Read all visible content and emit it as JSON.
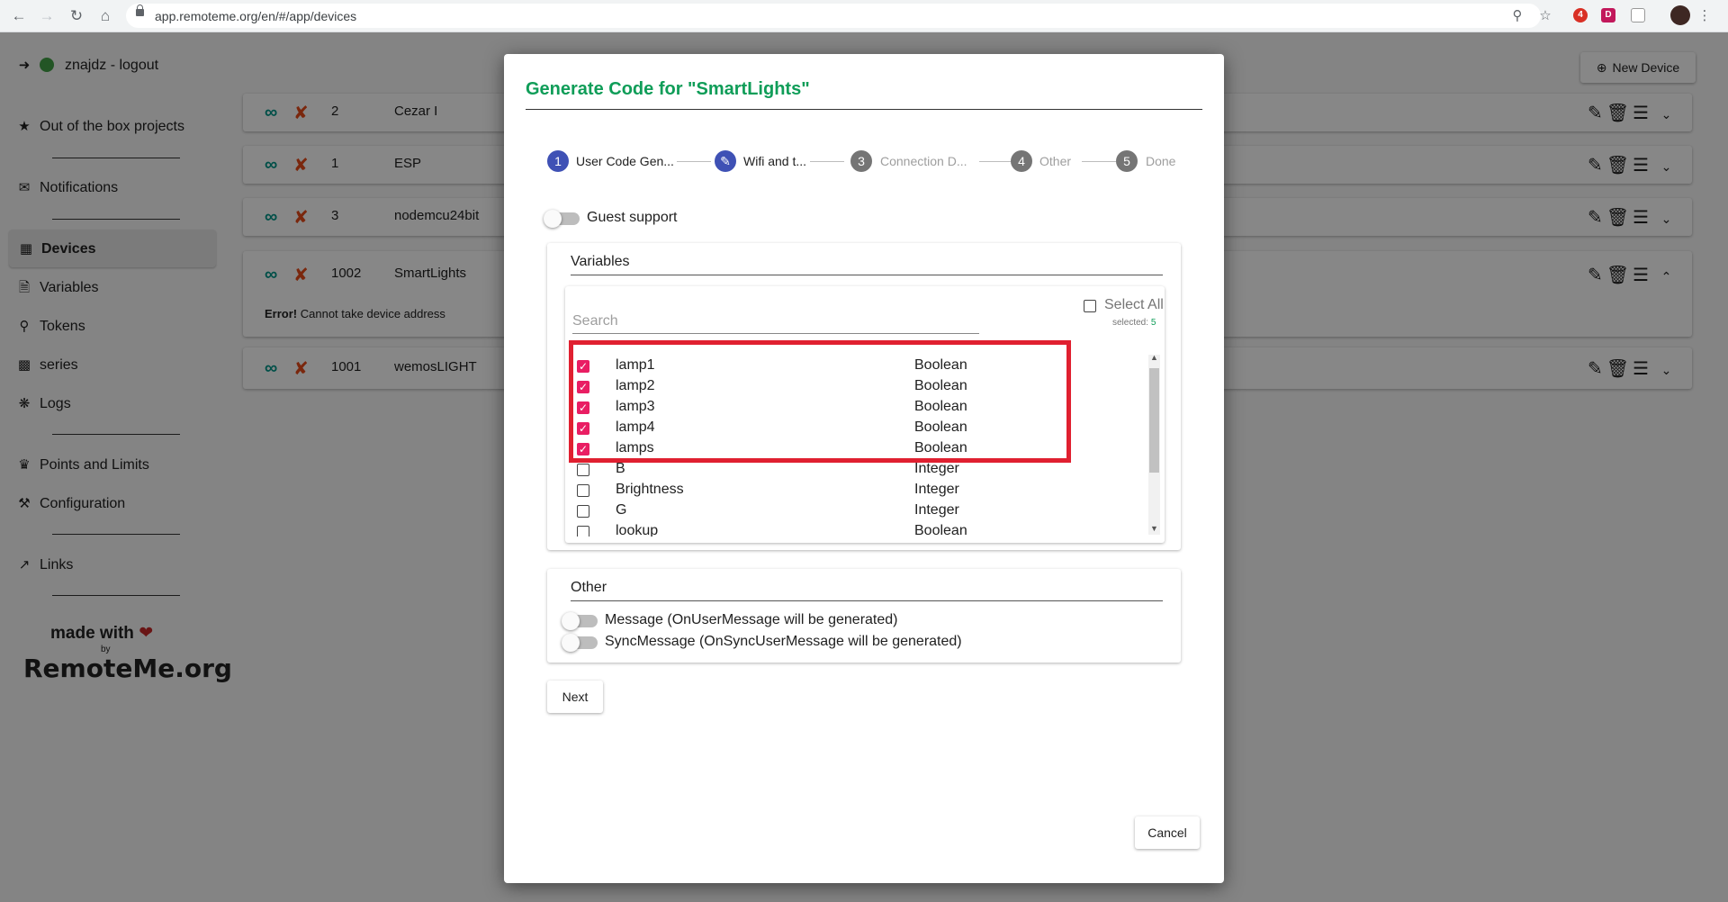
{
  "browser": {
    "url": "app.remoteme.org/en/#/app/devices",
    "extension_badge": "4",
    "extension_letter": "D"
  },
  "sidebar": {
    "user": "znajdz - logout",
    "items": [
      {
        "label": "Out of the box projects",
        "icon": "star-icon"
      },
      {
        "label": "Notifications",
        "icon": "envelope-icon"
      },
      {
        "label": "Devices",
        "icon": "chip-icon"
      },
      {
        "label": "Variables",
        "icon": "file-code-icon"
      },
      {
        "label": "Tokens",
        "icon": "key-icon"
      },
      {
        "label": "series",
        "icon": "bar-chart-icon"
      },
      {
        "label": "Logs",
        "icon": "bug-icon"
      },
      {
        "label": "Points and Limits",
        "icon": "trophy-icon"
      },
      {
        "label": "Configuration",
        "icon": "wrench-icon"
      },
      {
        "label": "Links",
        "icon": "external-link-icon"
      }
    ],
    "made_with": "made with",
    "by": "by",
    "logo": "RemoteMe.org"
  },
  "devices": [
    {
      "id": "2",
      "name": "Cezar I"
    },
    {
      "id": "1",
      "name": "ESP"
    },
    {
      "id": "3",
      "name": "nodemcu24bit"
    },
    {
      "id": "1002",
      "name": "SmartLights",
      "error_label": "Error!",
      "error_text": "Cannot take device address"
    },
    {
      "id": "1001",
      "name": "wemosLIGHT"
    }
  ],
  "new_device_label": "New Device",
  "dialog": {
    "title": "Generate Code for \"SmartLights\"",
    "steps": [
      {
        "num": "1",
        "label": "User Code Gen...",
        "state": "active"
      },
      {
        "num": "",
        "label": "Wifi and t...",
        "state": "edit"
      },
      {
        "num": "3",
        "label": "Connection D...",
        "state": "inactive"
      },
      {
        "num": "4",
        "label": "Other",
        "state": "inactive"
      },
      {
        "num": "5",
        "label": "Done",
        "state": "inactive"
      }
    ],
    "guest_support": "Guest support",
    "variables_title": "Variables",
    "select_all": "Select All",
    "selected_label": "selected:",
    "selected_count": "5",
    "search_placeholder": "Search",
    "variables": [
      {
        "name": "lamp1",
        "type": "Boolean",
        "checked": true
      },
      {
        "name": "lamp2",
        "type": "Boolean",
        "checked": true
      },
      {
        "name": "lamp3",
        "type": "Boolean",
        "checked": true
      },
      {
        "name": "lamp4",
        "type": "Boolean",
        "checked": true
      },
      {
        "name": "lamps",
        "type": "Boolean",
        "checked": true
      },
      {
        "name": "B",
        "type": "Integer",
        "checked": false
      },
      {
        "name": "Brightness",
        "type": "Integer",
        "checked": false
      },
      {
        "name": "G",
        "type": "Integer",
        "checked": false
      },
      {
        "name": "lookup",
        "type": "Boolean",
        "checked": false
      }
    ],
    "other_title": "Other",
    "message_option": "Message (OnUserMessage will be generated)",
    "sync_message_option": "SyncMessage (OnSyncUserMessage will be generated)",
    "next_label": "Next",
    "cancel_label": "Cancel"
  },
  "colors": {
    "accent_green": "#0f9d58",
    "step_active": "#3f51b5",
    "checkbox_pink": "#e91e63",
    "highlight_red": "#e02030"
  }
}
